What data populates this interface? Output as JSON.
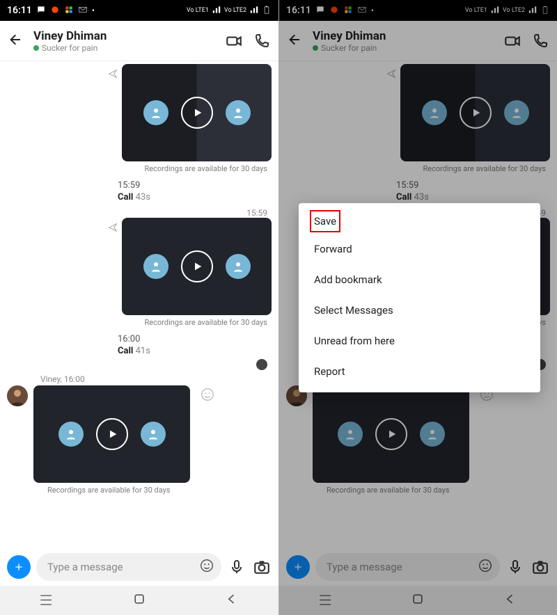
{
  "statusbar": {
    "time": "16:11",
    "net1": "Vo LTE1",
    "net2": "Vo LTE2"
  },
  "chat": {
    "contact_name": "Viney Dhiman",
    "contact_status": "Sucker for pain"
  },
  "messages": {
    "rec_caption": "Recordings are available for 30 days",
    "call1": {
      "time": "15:59",
      "label": "Call",
      "duration": "43s"
    },
    "ts2": "15:59",
    "call2": {
      "time": "16:00",
      "label": "Call",
      "duration": "41s"
    },
    "incoming": {
      "sender_line": "Viney, 16:00"
    }
  },
  "composer": {
    "placeholder": "Type a message"
  },
  "menu": {
    "items": [
      "Save",
      "Forward",
      "Add bookmark",
      "Select Messages",
      "Unread from here",
      "Report"
    ]
  },
  "nav": {
    "recents": "|||",
    "home": "○",
    "back": "‹"
  }
}
